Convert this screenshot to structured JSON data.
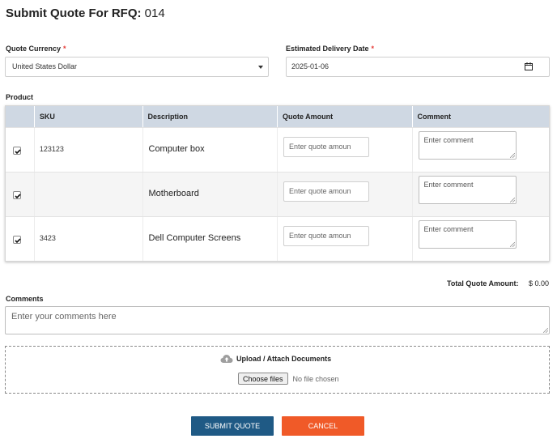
{
  "header": {
    "title_prefix": "Submit Quote For RFQ:",
    "rfq_number": "014"
  },
  "form": {
    "currency": {
      "label": "Quote Currency",
      "required_mark": "*",
      "selected": "United States Dollar"
    },
    "delivery_date": {
      "label": "Estimated Delivery Date",
      "required_mark": "*",
      "value": "2025-01-06"
    }
  },
  "product": {
    "section_label": "Product",
    "columns": [
      "",
      "SKU",
      "Description",
      "Quote Amount",
      "Comment"
    ],
    "rows": [
      {
        "checked": true,
        "sku": "123123",
        "description": "Computer box",
        "amount_placeholder": "Enter quote amoun",
        "comment_placeholder": "Enter comment"
      },
      {
        "checked": true,
        "sku": "",
        "description": "Motherboard",
        "amount_placeholder": "Enter quote amoun",
        "comment_placeholder": "Enter comment"
      },
      {
        "checked": true,
        "sku": "3423",
        "description": "Dell Computer Screens",
        "amount_placeholder": "Enter quote amoun",
        "comment_placeholder": "Enter comment"
      }
    ]
  },
  "totals": {
    "label": "Total Quote Amount:",
    "value": "$ 0.00"
  },
  "comments": {
    "label": "Comments",
    "placeholder": "Enter your comments here"
  },
  "upload": {
    "title": "Upload / Attach Documents",
    "button_label": "Choose files",
    "status": "No file chosen"
  },
  "actions": {
    "submit_label": "SUBMIT QUOTE",
    "cancel_label": "CANCEL"
  },
  "colors": {
    "table_header": "#cfd8e3",
    "submit": "#1f5a85",
    "cancel": "#f05a28",
    "required": "#e53935"
  }
}
